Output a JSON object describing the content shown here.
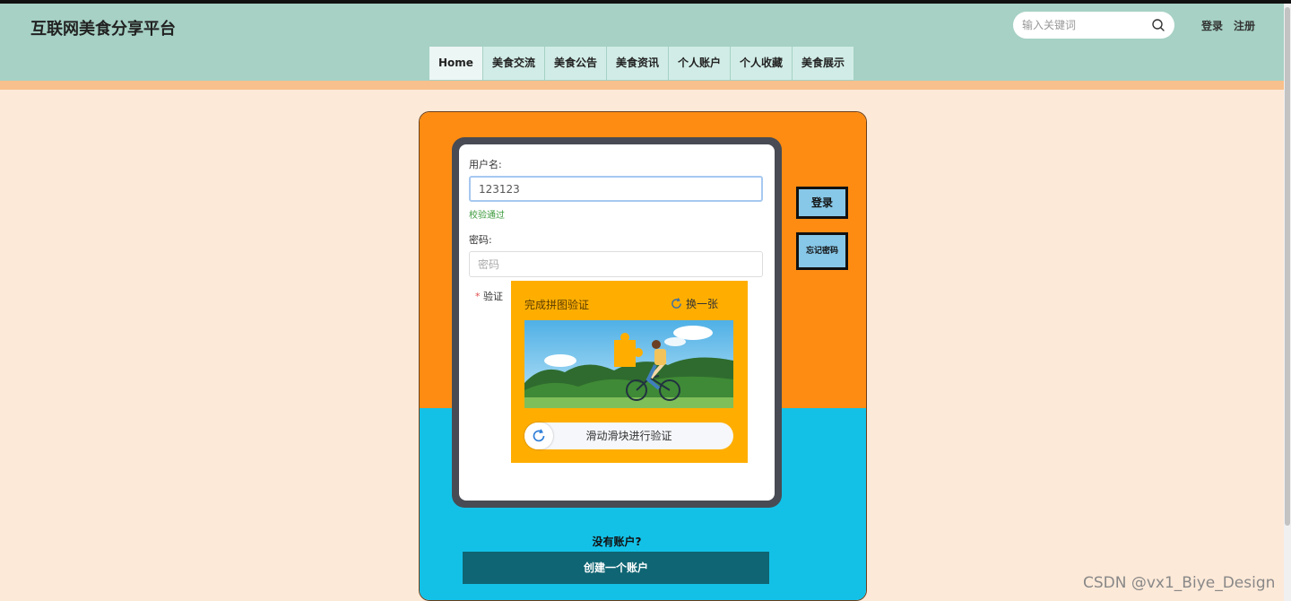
{
  "header": {
    "site_title": "互联网美食分享平台",
    "search_placeholder": "输入关键词",
    "login_link": "登录",
    "register_link": "注册"
  },
  "nav": {
    "items": [
      {
        "label": "Home",
        "active": true
      },
      {
        "label": "美食交流"
      },
      {
        "label": "美食公告"
      },
      {
        "label": "美食资讯"
      },
      {
        "label": "个人账户"
      },
      {
        "label": "个人收藏"
      },
      {
        "label": "美食展示"
      }
    ]
  },
  "login_form": {
    "username_label": "用户名:",
    "username_value": "123123",
    "username_status": "校验通过",
    "password_label": "密码:",
    "password_placeholder": "密码",
    "verify_required_mark": "*",
    "verify_label": "验证",
    "login_button": "登录",
    "forgot_button": "忘记密码"
  },
  "captcha": {
    "title": "完成拼图验证",
    "refresh_label": "换一张",
    "slider_text": "滑动滑块进行验证"
  },
  "signup": {
    "prompt": "没有账户?",
    "button": "创建一个账户"
  },
  "watermark": "CSDN @vx1_Biye_Design",
  "colors": {
    "header_bg": "#a6d1c4",
    "page_bg": "#fde9d8",
    "card_orange": "#ff8c12",
    "card_blue": "#13c1e7",
    "captcha_bg": "#ffae00",
    "create_button": "#0f6573",
    "side_button": "#87c7e7"
  }
}
